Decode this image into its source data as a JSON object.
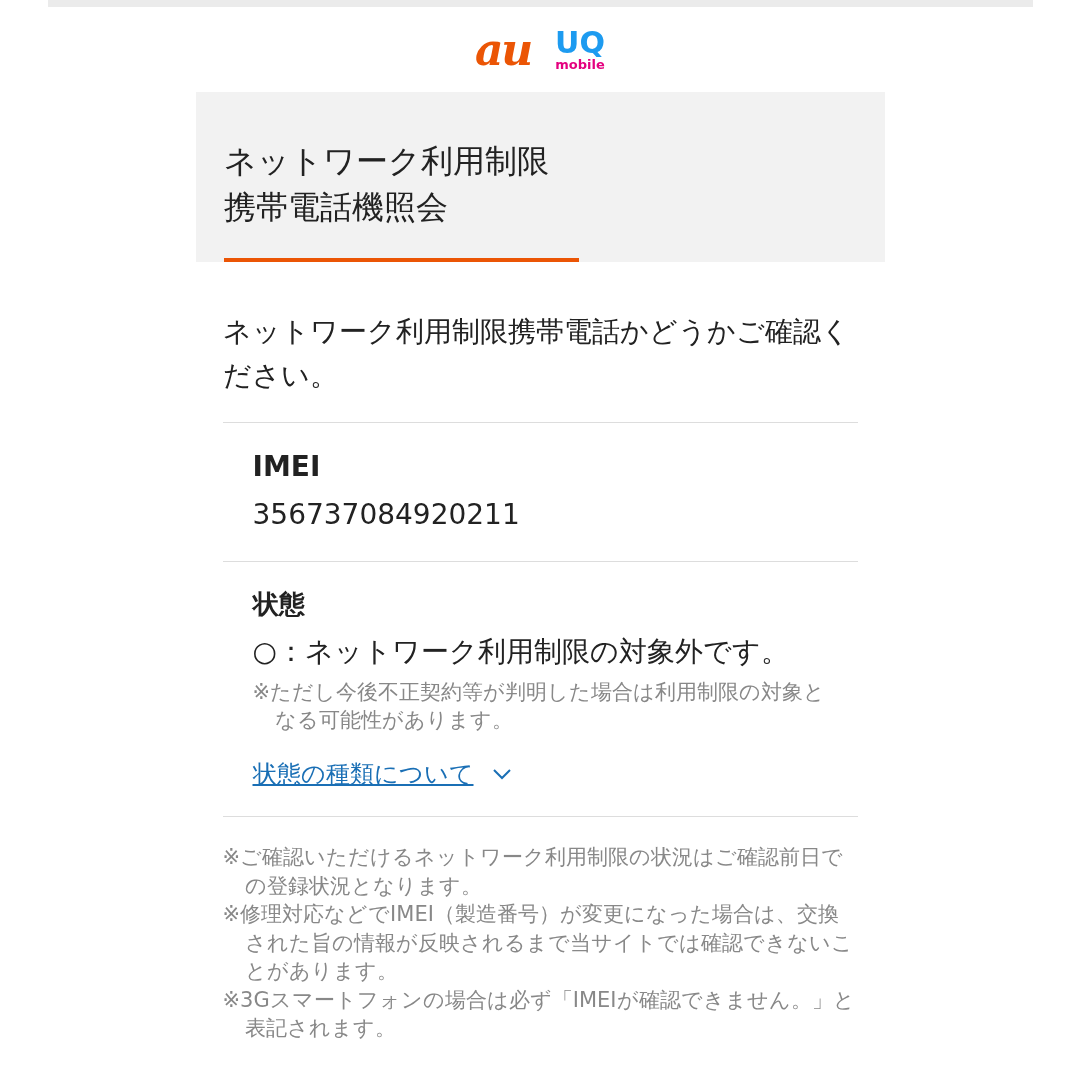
{
  "logos": {
    "au": "au",
    "uq": "UQ",
    "uq_sub": "mobile"
  },
  "header": {
    "title_lines": [
      "ネットワーク利用制限",
      "携帯電話機照会"
    ]
  },
  "intro": "ネットワーク利用制限携帯電話かどうかご確認ください。",
  "imei": {
    "label": "IMEI",
    "value": "356737084920211"
  },
  "status": {
    "label": "状態",
    "value": "○：ネットワーク利用制限の対象外です。",
    "note": "※ただし今後不正契約等が判明した場合は利用制限の対象となる可能性があります。",
    "link": {
      "text": "状態の種類について",
      "expanded": false
    }
  },
  "notes": [
    "※ご確認いただけるネットワーク利用制限の状況はご確認前日での登録状況となります。",
    "※修理対応などでIMEI（製造番号）が変更になった場合は、交換された旨の情報が反映されるまで当サイトでは確認できないことがあります。",
    "※3Gスマートフォンの場合は必ず「IMEIが確認できません。」と表記されます。"
  ]
}
